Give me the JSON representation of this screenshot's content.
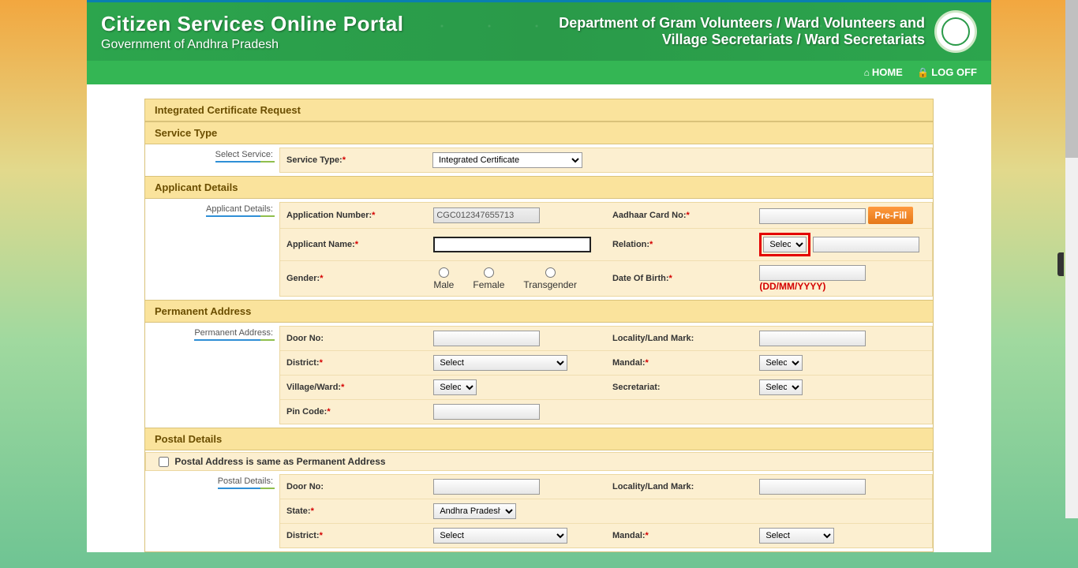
{
  "header": {
    "title": "Citizen Services Online Portal",
    "subtitle": "Government of Andhra Pradesh",
    "dept_l1": "Department of Gram Volunteers / Ward Volunteers and",
    "dept_l2": "Village Secretariats / Ward Secretariats"
  },
  "nav": {
    "home": "HOME",
    "logoff": "LOG OFF"
  },
  "page": {
    "title": "Integrated Certificate Request"
  },
  "serviceType": {
    "section": "Service Type",
    "sideLabel": "Select Service:",
    "label": "Service Type:",
    "value": "Integrated Certificate"
  },
  "applicant": {
    "section": "Applicant Details",
    "sideLabel": "Applicant Details:",
    "appNo_lbl": "Application Number:",
    "appNo_val": "CGC012347655713",
    "aadhaar_lbl": "Aadhaar Card No:",
    "prefill": "Pre-Fill",
    "name_lbl": "Applicant Name:",
    "relation_lbl": "Relation:",
    "relation_opt": "Select",
    "gender_lbl": "Gender:",
    "gender_m": "Male",
    "gender_f": "Female",
    "gender_t": "Transgender",
    "dob_lbl": "Date Of Birth:",
    "dob_hint": "(DD/MM/YYYY)"
  },
  "permAddr": {
    "section": "Permanent Address",
    "sideLabel": "Permanent Address:",
    "door_lbl": "Door No:",
    "locality_lbl": "Locality/Land Mark:",
    "district_lbl": "District:",
    "district_opt": "Select",
    "mandal_lbl": "Mandal:",
    "mandal_opt": "Select",
    "village_lbl": "Village/Ward:",
    "village_opt": "Select",
    "secretariat_lbl": "Secretariat:",
    "secretariat_opt": "Select",
    "pin_lbl": "Pin Code:"
  },
  "postal": {
    "section": "Postal Details",
    "same_lbl": "Postal Address is same as Permanent Address",
    "sideLabel": "Postal Details:",
    "door_lbl": "Door No:",
    "locality_lbl": "Locality/Land Mark:",
    "state_lbl": "State:",
    "state_val": "Andhra Pradesh",
    "district_lbl": "District:",
    "district_opt": "Select",
    "mandal_lbl": "Mandal:",
    "mandal_opt": "Select"
  }
}
